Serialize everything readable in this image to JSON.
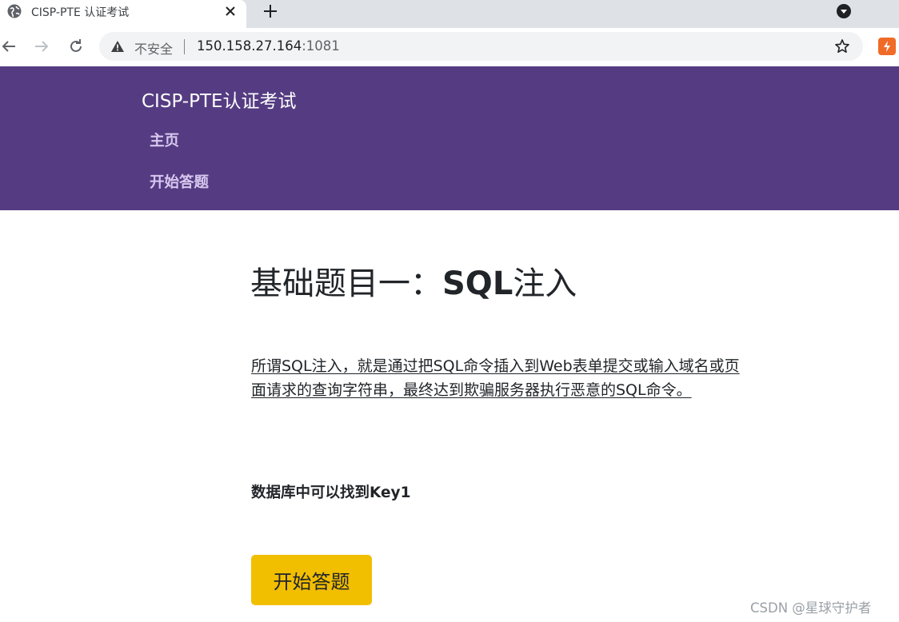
{
  "browser": {
    "tab": {
      "title": "CISP-PTE 认证考试"
    },
    "address_bar": {
      "security_label": "不安全",
      "host": "150.158.27.164",
      "port": ":1081"
    }
  },
  "site": {
    "brand": "CISP-PTE认证考试",
    "nav": {
      "home": "主页",
      "start": "开始答题"
    }
  },
  "main": {
    "title_prefix": "基础题目一：",
    "title_strong": "SQL",
    "title_suffix": "注入",
    "intro": "所谓SQL注入，就是通过把SQL命令插入到Web表单提交或输入域名或页面请求的查询字符串，最终达到欺骗服务器执行恶意的SQL命令。",
    "hint": "数据库中可以找到Key1",
    "start_button": "开始答题"
  },
  "watermark": "CSDN @星球守护者",
  "colors": {
    "header_bg": "#553c82",
    "nav_link": "#d7c8ef",
    "button_bg": "#f2be00"
  }
}
